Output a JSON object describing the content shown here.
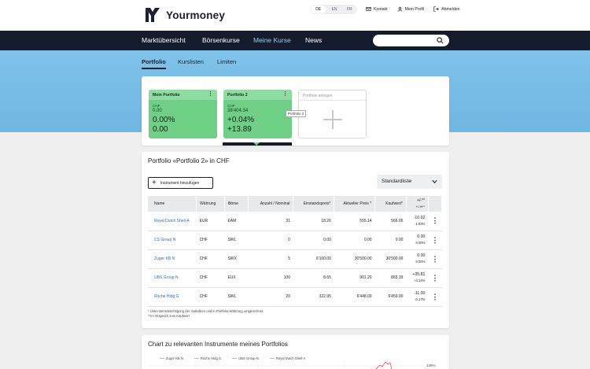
{
  "brand": {
    "name": "Yourmoney"
  },
  "language": {
    "options": [
      "DE",
      "EN",
      "FR"
    ],
    "selected": "DE"
  },
  "top_links": {
    "contact": "Kontakt",
    "profile": "Mein Profil",
    "logout": "Abmelden"
  },
  "nav": {
    "items": [
      "Marktübersicht",
      "Börsenkurse",
      "Meine Kurse",
      "News"
    ],
    "active": "Meine Kurse"
  },
  "search": {
    "placeholder": ""
  },
  "subnav": {
    "items": [
      "Portfolio",
      "Kurslisten",
      "Limiten"
    ],
    "active": "Portfolio"
  },
  "portfolios": [
    {
      "name": "Mein Portfolio",
      "currency": "CHF",
      "value": "0.00",
      "change_pct": "0.00%",
      "change_abs": "0.00"
    },
    {
      "name": "Portfolio 2",
      "currency": "CHF",
      "value": "38'404.34",
      "change_pct": "+0.04%",
      "change_abs": "+13.89"
    }
  ],
  "new_portfolio_label": "Portfolio anlegen",
  "tooltip": "Portfolio 2",
  "section": {
    "title": "Portfolio «Portfolio 2» in CHF",
    "add_button": "Instrument hinzufügen",
    "list_select": "Standardliste"
  },
  "table": {
    "headers": [
      "Name",
      "Währung",
      "Börse",
      "Anzahl / Nominal",
      "Einstandspreis*",
      "Aktueller Preis *",
      "Kaufwert*",
      "+/-**",
      "+/-%**"
    ],
    "rows": [
      {
        "name": "Royal Dutch Shell-A",
        "currency": "EUR",
        "exchange": "EAM",
        "qty": "31",
        "cost": "18.26",
        "price": "555.14",
        "value": "566.05",
        "chg": "-10.92",
        "chg_pct": "-1.93%",
        "dir": "neg"
      },
      {
        "name": "CS Group N",
        "currency": "CHF",
        "exchange": "SWL",
        "qty": "0",
        "cost": "0.00",
        "price": "0.00",
        "value": "0.00",
        "chg": "0.00",
        "chg_pct": "0.00%",
        "dir": "zer"
      },
      {
        "name": "Zuger KB N",
        "currency": "CHF",
        "exchange": "SWX",
        "qty": "5",
        "cost": "6'100.00",
        "price": "30'500.00",
        "value": "30'500.00",
        "chg": "0.00",
        "chg_pct": "0.00%",
        "dir": "zer"
      },
      {
        "name": "UBS Group N",
        "currency": "CHF",
        "exchange": "EUX",
        "qty": "100",
        "cost": "8.65",
        "price": "901.20",
        "value": "865.39",
        "chg": "+35.81",
        "chg_pct": "+4.14%",
        "dir": "pos"
      },
      {
        "name": "Roche Hldg G",
        "currency": "CHF",
        "exchange": "SWL",
        "qty": "20",
        "cost": "322.95",
        "price": "6'448.00",
        "value": "6'459.00",
        "chg": "-11.00",
        "chg_pct": "-0.17%",
        "dir": "neg"
      }
    ]
  },
  "footnotes": [
    "* Unter Berücksichtigung der Gebühren und in Portfolio-Währung umgerechnet.",
    "**im Vergleich zum Kaufwert"
  ],
  "chart_section": {
    "title": "Chart zu relevanten Instrumente meines Portfolios",
    "legend": [
      "Zuger KB N",
      "Roche Hldg G",
      "UBS Group N",
      "Royal Dutch Shell-A"
    ],
    "axis_label": "125%"
  },
  "colors": {
    "nav_bg": "#141b2d",
    "accent": "#8ed1f3",
    "card_green": "#6fcf86",
    "neg": "#e03b3b",
    "pos": "#3aa54a"
  }
}
